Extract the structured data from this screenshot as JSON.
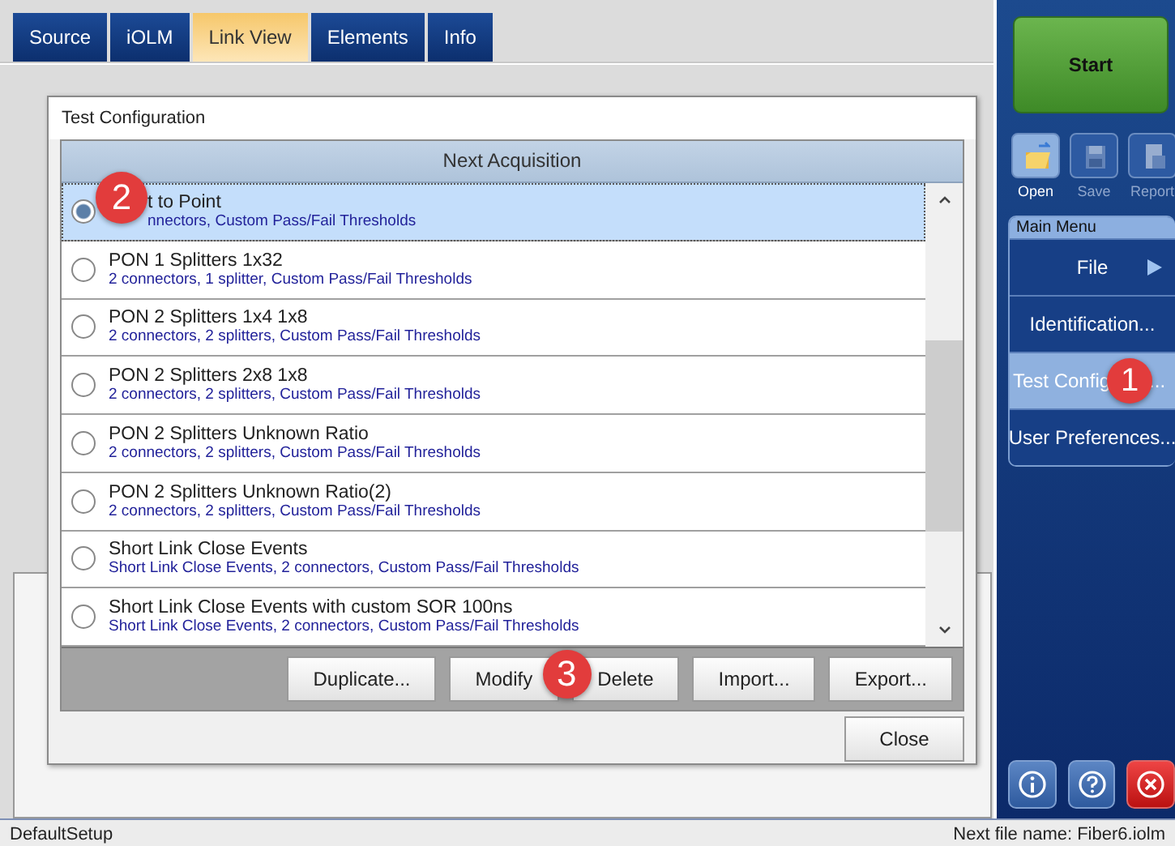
{
  "tabs": [
    {
      "label": "Source",
      "selected": false
    },
    {
      "label": "iOLM",
      "selected": false
    },
    {
      "label": "Link View",
      "selected": true
    },
    {
      "label": "Elements",
      "selected": false
    },
    {
      "label": "Info",
      "selected": false
    }
  ],
  "dialog": {
    "title": "Test Configuration",
    "list_header": "Next Acquisition",
    "rows": [
      {
        "title": "t to Point",
        "detail": "nnectors, Custom Pass/Fail Thresholds",
        "selected": true,
        "marker": "2"
      },
      {
        "title": "PON 1 Splitters 1x32",
        "detail": "2 connectors, 1 splitter, Custom Pass/Fail Thresholds",
        "selected": false
      },
      {
        "title": "PON 2 Splitters 1x4 1x8",
        "detail": "2 connectors, 2 splitters, Custom Pass/Fail Thresholds",
        "selected": false
      },
      {
        "title": "PON 2 Splitters 2x8 1x8",
        "detail": "2 connectors, 2 splitters, Custom Pass/Fail Thresholds",
        "selected": false
      },
      {
        "title": "PON 2 Splitters Unknown Ratio",
        "detail": "2 connectors, 2 splitters, Custom Pass/Fail Thresholds",
        "selected": false
      },
      {
        "title": "PON 2 Splitters Unknown Ratio(2)",
        "detail": "2 connectors, 2 splitters, Custom Pass/Fail Thresholds",
        "selected": false
      },
      {
        "title": "Short Link Close Events",
        "detail": "Short Link Close Events, 2 connectors, Custom Pass/Fail Thresholds",
        "selected": false
      },
      {
        "title": "Short Link Close Events with custom SOR 100ns",
        "detail": "Short Link Close Events, 2 connectors, Custom Pass/Fail Thresholds",
        "selected": false
      }
    ],
    "buttons": [
      {
        "label": "Duplicate..."
      },
      {
        "label": "Modify",
        "marker": "3"
      },
      {
        "label": "Delete"
      },
      {
        "label": "Import..."
      },
      {
        "label": "Export..."
      }
    ],
    "close_button": "Close"
  },
  "side_panel": {
    "start_button": "Start",
    "tools": [
      {
        "label": "Open",
        "kind": "open",
        "disabled": false
      },
      {
        "label": "Save",
        "kind": "save",
        "disabled": true
      },
      {
        "label": "Report",
        "kind": "report",
        "disabled": true
      }
    ],
    "menu_title": "Main Menu",
    "menu_items": [
      {
        "label": "File",
        "submenu": true,
        "selected": false
      },
      {
        "label": "Identification...",
        "submenu": false,
        "selected": false
      },
      {
        "label": "Test Config",
        "tail": "...",
        "marker": "1",
        "submenu": false,
        "selected": true
      },
      {
        "label": "User Preferences...",
        "submenu": false,
        "selected": false
      }
    ],
    "bottom_buttons": [
      {
        "kind": "info"
      },
      {
        "kind": "help"
      },
      {
        "kind": "exit"
      }
    ]
  },
  "status_bar": {
    "left": "DefaultSetup",
    "right": "Next file name: Fiber6.iolm"
  }
}
